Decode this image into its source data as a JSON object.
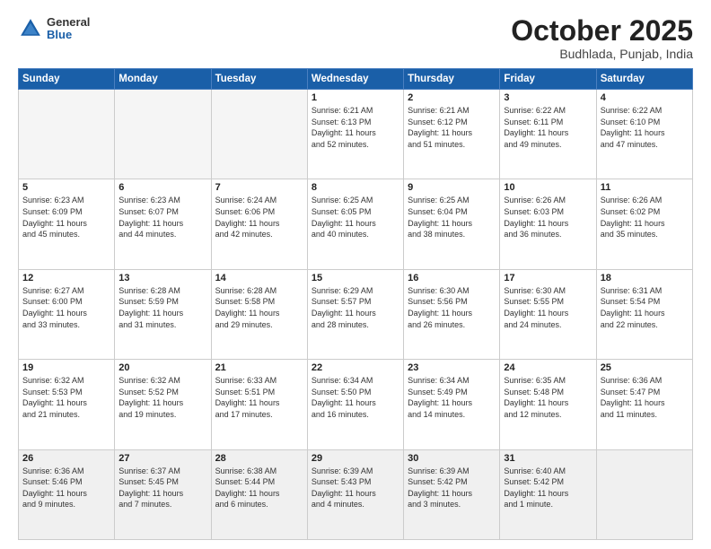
{
  "header": {
    "logo": {
      "general": "General",
      "blue": "Blue"
    },
    "title": "October 2025",
    "location": "Budhlada, Punjab, India"
  },
  "weekdays": [
    "Sunday",
    "Monday",
    "Tuesday",
    "Wednesday",
    "Thursday",
    "Friday",
    "Saturday"
  ],
  "weeks": [
    [
      {
        "day": "",
        "info": ""
      },
      {
        "day": "",
        "info": ""
      },
      {
        "day": "",
        "info": ""
      },
      {
        "day": "1",
        "info": "Sunrise: 6:21 AM\nSunset: 6:13 PM\nDaylight: 11 hours\nand 52 minutes."
      },
      {
        "day": "2",
        "info": "Sunrise: 6:21 AM\nSunset: 6:12 PM\nDaylight: 11 hours\nand 51 minutes."
      },
      {
        "day": "3",
        "info": "Sunrise: 6:22 AM\nSunset: 6:11 PM\nDaylight: 11 hours\nand 49 minutes."
      },
      {
        "day": "4",
        "info": "Sunrise: 6:22 AM\nSunset: 6:10 PM\nDaylight: 11 hours\nand 47 minutes."
      }
    ],
    [
      {
        "day": "5",
        "info": "Sunrise: 6:23 AM\nSunset: 6:09 PM\nDaylight: 11 hours\nand 45 minutes."
      },
      {
        "day": "6",
        "info": "Sunrise: 6:23 AM\nSunset: 6:07 PM\nDaylight: 11 hours\nand 44 minutes."
      },
      {
        "day": "7",
        "info": "Sunrise: 6:24 AM\nSunset: 6:06 PM\nDaylight: 11 hours\nand 42 minutes."
      },
      {
        "day": "8",
        "info": "Sunrise: 6:25 AM\nSunset: 6:05 PM\nDaylight: 11 hours\nand 40 minutes."
      },
      {
        "day": "9",
        "info": "Sunrise: 6:25 AM\nSunset: 6:04 PM\nDaylight: 11 hours\nand 38 minutes."
      },
      {
        "day": "10",
        "info": "Sunrise: 6:26 AM\nSunset: 6:03 PM\nDaylight: 11 hours\nand 36 minutes."
      },
      {
        "day": "11",
        "info": "Sunrise: 6:26 AM\nSunset: 6:02 PM\nDaylight: 11 hours\nand 35 minutes."
      }
    ],
    [
      {
        "day": "12",
        "info": "Sunrise: 6:27 AM\nSunset: 6:00 PM\nDaylight: 11 hours\nand 33 minutes."
      },
      {
        "day": "13",
        "info": "Sunrise: 6:28 AM\nSunset: 5:59 PM\nDaylight: 11 hours\nand 31 minutes."
      },
      {
        "day": "14",
        "info": "Sunrise: 6:28 AM\nSunset: 5:58 PM\nDaylight: 11 hours\nand 29 minutes."
      },
      {
        "day": "15",
        "info": "Sunrise: 6:29 AM\nSunset: 5:57 PM\nDaylight: 11 hours\nand 28 minutes."
      },
      {
        "day": "16",
        "info": "Sunrise: 6:30 AM\nSunset: 5:56 PM\nDaylight: 11 hours\nand 26 minutes."
      },
      {
        "day": "17",
        "info": "Sunrise: 6:30 AM\nSunset: 5:55 PM\nDaylight: 11 hours\nand 24 minutes."
      },
      {
        "day": "18",
        "info": "Sunrise: 6:31 AM\nSunset: 5:54 PM\nDaylight: 11 hours\nand 22 minutes."
      }
    ],
    [
      {
        "day": "19",
        "info": "Sunrise: 6:32 AM\nSunset: 5:53 PM\nDaylight: 11 hours\nand 21 minutes."
      },
      {
        "day": "20",
        "info": "Sunrise: 6:32 AM\nSunset: 5:52 PM\nDaylight: 11 hours\nand 19 minutes."
      },
      {
        "day": "21",
        "info": "Sunrise: 6:33 AM\nSunset: 5:51 PM\nDaylight: 11 hours\nand 17 minutes."
      },
      {
        "day": "22",
        "info": "Sunrise: 6:34 AM\nSunset: 5:50 PM\nDaylight: 11 hours\nand 16 minutes."
      },
      {
        "day": "23",
        "info": "Sunrise: 6:34 AM\nSunset: 5:49 PM\nDaylight: 11 hours\nand 14 minutes."
      },
      {
        "day": "24",
        "info": "Sunrise: 6:35 AM\nSunset: 5:48 PM\nDaylight: 11 hours\nand 12 minutes."
      },
      {
        "day": "25",
        "info": "Sunrise: 6:36 AM\nSunset: 5:47 PM\nDaylight: 11 hours\nand 11 minutes."
      }
    ],
    [
      {
        "day": "26",
        "info": "Sunrise: 6:36 AM\nSunset: 5:46 PM\nDaylight: 11 hours\nand 9 minutes."
      },
      {
        "day": "27",
        "info": "Sunrise: 6:37 AM\nSunset: 5:45 PM\nDaylight: 11 hours\nand 7 minutes."
      },
      {
        "day": "28",
        "info": "Sunrise: 6:38 AM\nSunset: 5:44 PM\nDaylight: 11 hours\nand 6 minutes."
      },
      {
        "day": "29",
        "info": "Sunrise: 6:39 AM\nSunset: 5:43 PM\nDaylight: 11 hours\nand 4 minutes."
      },
      {
        "day": "30",
        "info": "Sunrise: 6:39 AM\nSunset: 5:42 PM\nDaylight: 11 hours\nand 3 minutes."
      },
      {
        "day": "31",
        "info": "Sunrise: 6:40 AM\nSunset: 5:42 PM\nDaylight: 11 hours\nand 1 minute."
      },
      {
        "day": "",
        "info": ""
      }
    ]
  ]
}
